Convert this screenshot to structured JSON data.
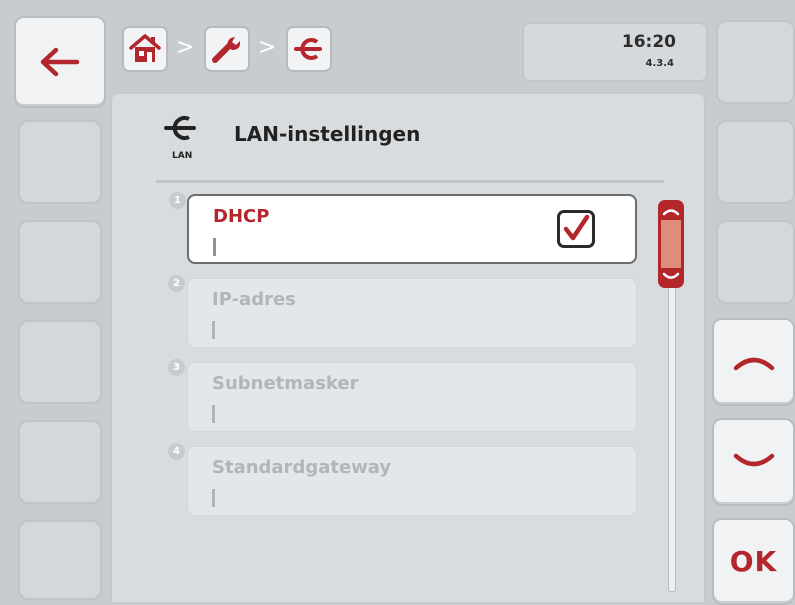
{
  "header": {
    "time": "16:20",
    "version": "4.3.4",
    "breadcrumb": [
      {
        "icon": "home-icon"
      },
      {
        "icon": "wrench-icon"
      },
      {
        "icon": "lan-icon"
      }
    ],
    "separator": ">"
  },
  "page": {
    "title": "LAN-instellingen",
    "icon_caption": "LAN"
  },
  "items": [
    {
      "number": "1",
      "label": "DHCP",
      "value": "",
      "checked": true
    },
    {
      "number": "2",
      "label": "IP-adres",
      "value": ""
    },
    {
      "number": "3",
      "label": "Subnetmasker",
      "value": ""
    },
    {
      "number": "4",
      "label": "Standardgateway",
      "value": ""
    }
  ],
  "right_panel": {
    "ok_label": "OK"
  },
  "colors": {
    "accent": "#b3262c",
    "accent_light": "#dd8d79",
    "background": "#c9ccce",
    "panel": "#d9dcde"
  }
}
